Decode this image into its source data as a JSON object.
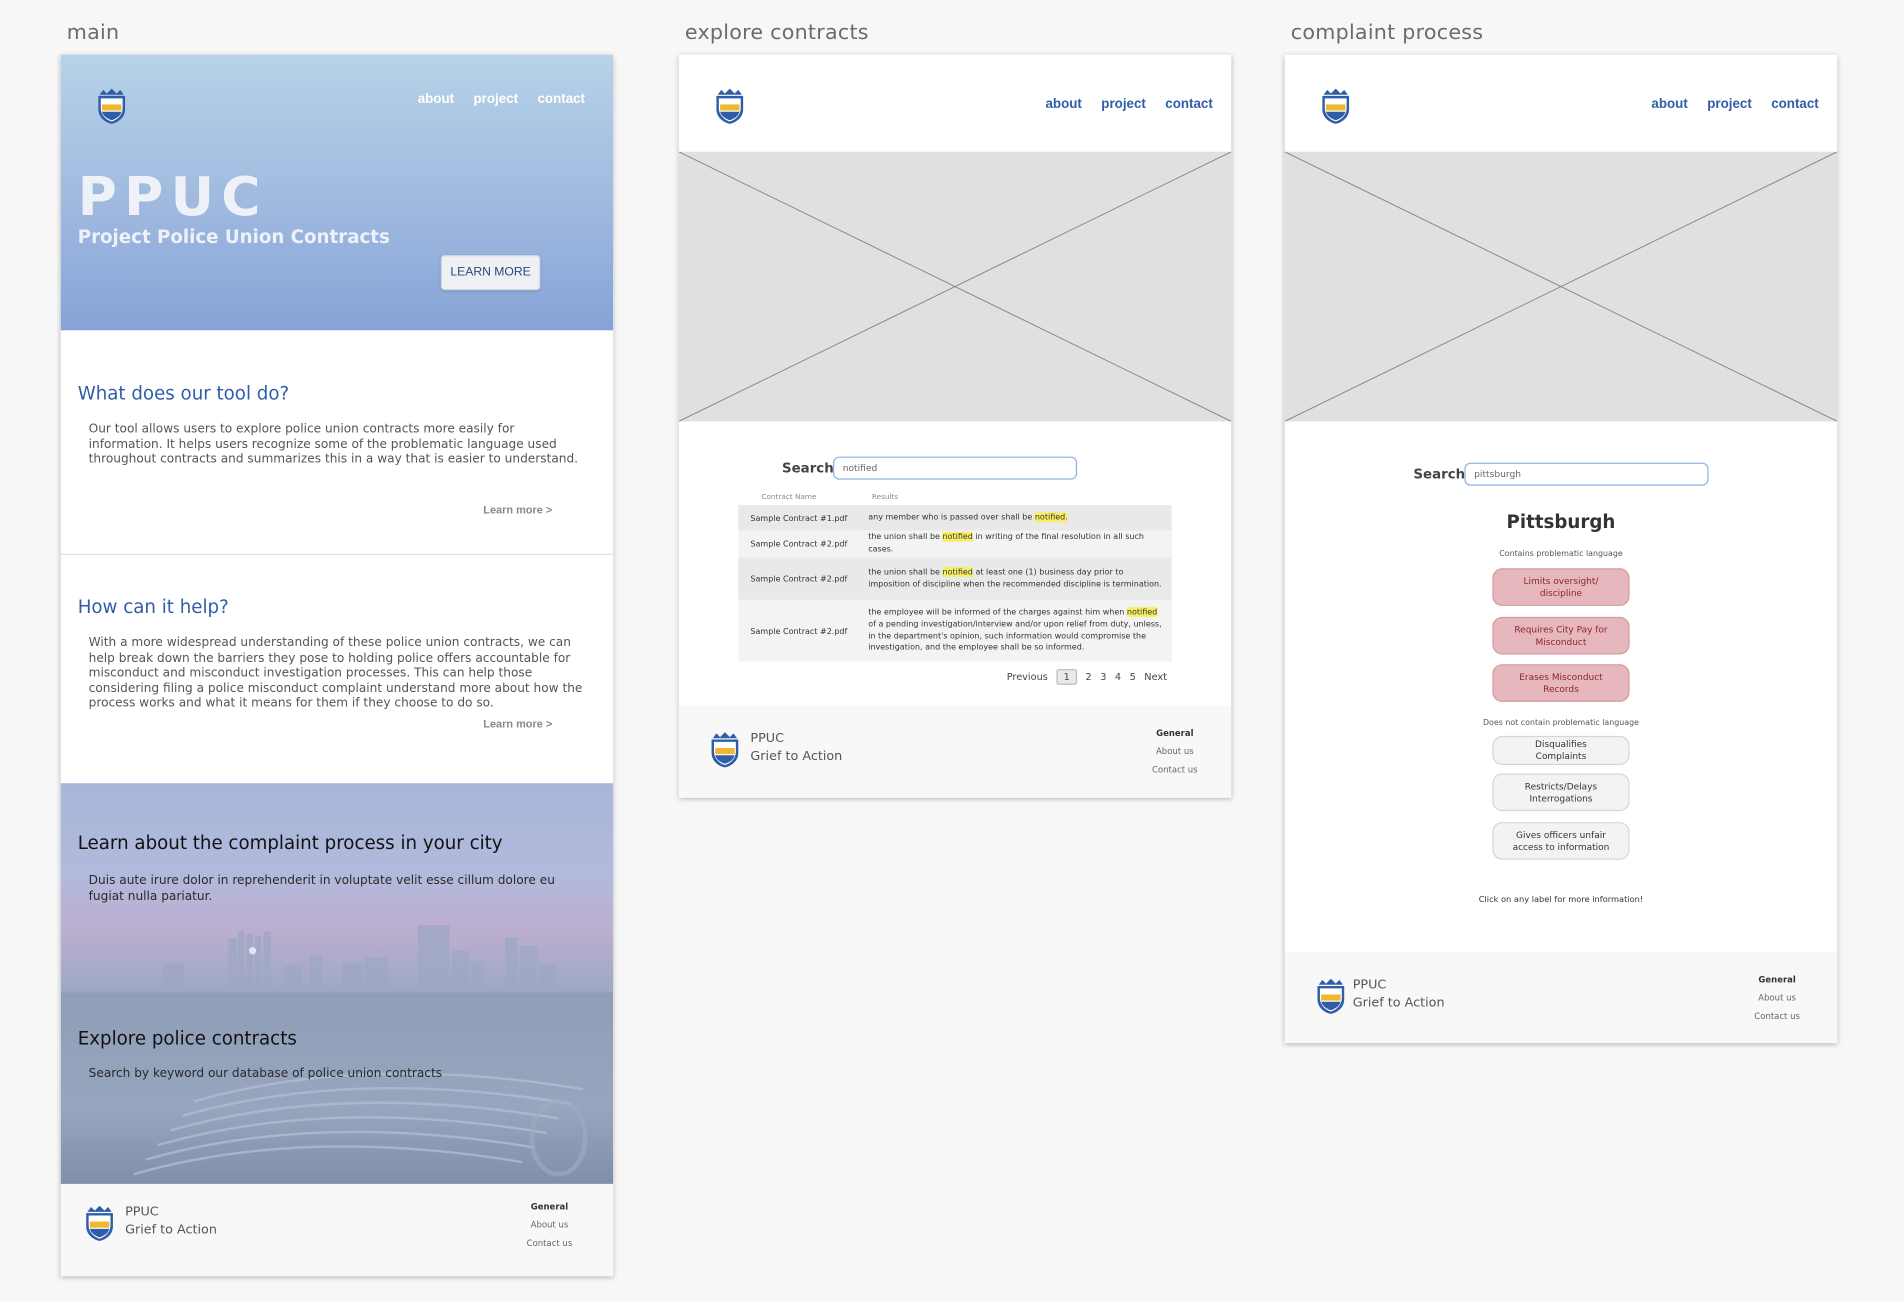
{
  "colors": {
    "brand_blue": "#2f5da8",
    "highlight": "#f9ef64",
    "problem_tag": "#e6b7bc",
    "neutral_tag": "#f3f3f3"
  },
  "artboards": {
    "main_label": "main",
    "explore_label": "explore contracts",
    "complaint_label": "complaint process"
  },
  "nav": {
    "about": "about",
    "project": "project",
    "contact": "contact"
  },
  "main": {
    "hero_title": "PPUC",
    "hero_subtitle": "Project Police Union Contracts",
    "learn_more_button": "LEARN MORE",
    "section1_title": "What does our tool do?",
    "section1_body": "Our tool allows users to explore police union contracts more easily for information. It helps users recognize some of the problematic language used throughout contracts and summarizes this in a way that is easier to understand.",
    "section1_link": "Learn more >",
    "section2_title": "How can it help?",
    "section2_body": "With a more widespread understanding of these police union contracts, we can help break down the barriers they pose to holding police offers accountable for misconduct and misconduct investigation processes. This can help those considering filing a police misconduct complaint understand more about how the process works and what it means for them if they choose to do so.",
    "section2_link": "Learn more >",
    "section3_title": "Learn about the complaint process in your city",
    "section3_body": "Duis aute irure dolor in reprehenderit in voluptate velit esse cillum dolore eu fugiat nulla pariatur.",
    "section4_title": "Explore police contracts",
    "section4_body": "Search by keyword our database of police union contracts"
  },
  "footer": {
    "name": "PPUC",
    "tagline": "Grief to Action",
    "col_title": "General",
    "about": "About us",
    "contact": "Contact us"
  },
  "explore": {
    "search_label": "Search",
    "search_value": "notified",
    "col_name": "Contract Name",
    "col_results": "Results",
    "rows": [
      {
        "name": "Sample Contract #1.pdf",
        "pre": "any member who is passed over shall be ",
        "hit": "notified.",
        "post": ""
      },
      {
        "name": "Sample Contract #2.pdf",
        "pre": "the union shall be ",
        "hit": "notified",
        "post": " in writing of the final resolution in all such cases."
      },
      {
        "name": "Sample Contract #2.pdf",
        "pre": "the union shall be ",
        "hit": "notified",
        "post": " at least one (1) business day prior to imposition of discipline when the recommended discipline is termination."
      },
      {
        "name": "Sample Contract #2.pdf",
        "pre": "the employee will be informed of the charges against him when ",
        "hit": "notified",
        "post": " of a pending investigation/interview and/or upon relief from duty, unless, in the department's opinion, such information would compromise the investigation, and the employee shall be so informed."
      }
    ],
    "pager": {
      "prev": "Previous",
      "pages": [
        "1",
        "2",
        "3",
        "4",
        "5"
      ],
      "current": "1",
      "next": "Next"
    }
  },
  "complaint": {
    "search_label": "Search",
    "search_value": "pittsburgh",
    "city": "Pittsburgh",
    "contains_label": "Contains problematic language",
    "problem_tags": [
      "Limits oversight/ discipline",
      "Requires City Pay for Misconduct",
      "Erases Misconduct Records"
    ],
    "not_contains_label": "Does not contain problematic language",
    "ok_tags": [
      "Disqualifies Complaints",
      "Restricts/Delays Interrogations",
      "Gives officers unfair access to information"
    ],
    "hint": "Click on any label for more information!"
  }
}
